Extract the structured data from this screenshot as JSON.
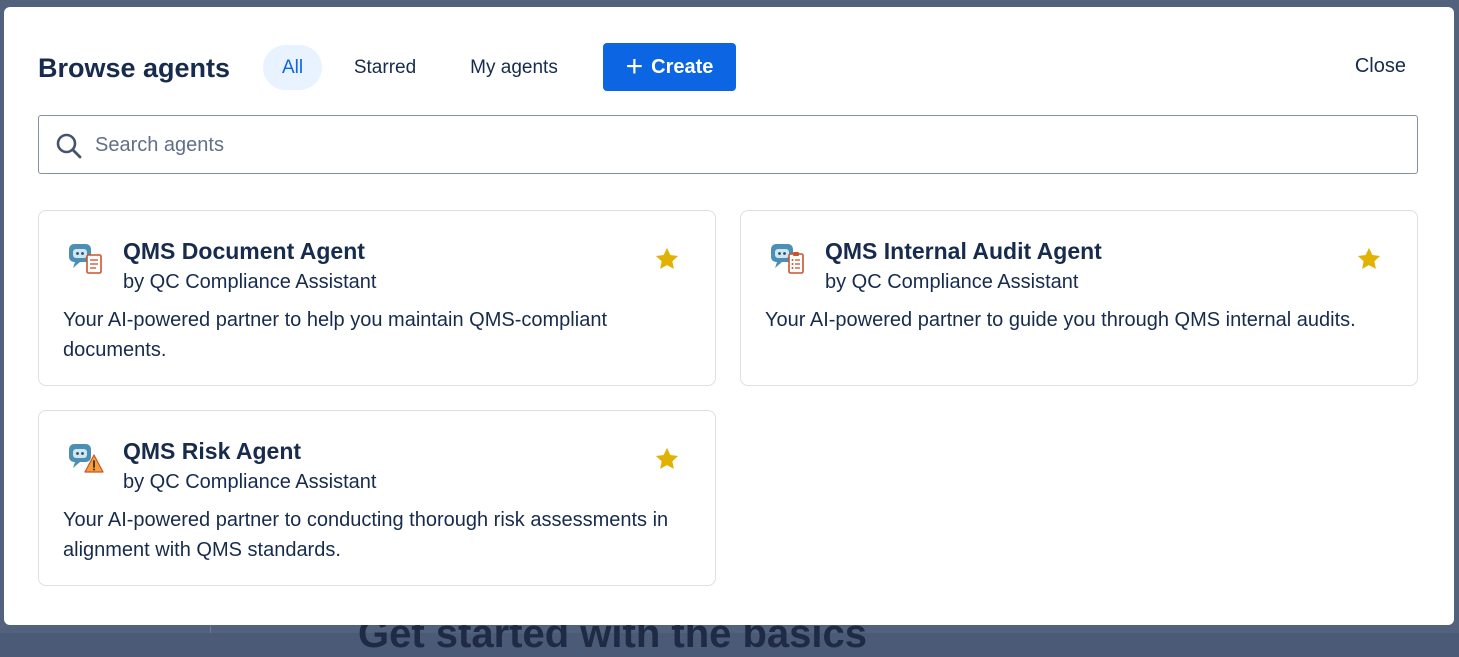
{
  "header": {
    "title": "Browse agents",
    "tabs": [
      {
        "label": "All",
        "active": true
      },
      {
        "label": "Starred",
        "active": false
      },
      {
        "label": "My agents",
        "active": false
      }
    ],
    "create_label": "Create",
    "close_label": "Close"
  },
  "search": {
    "placeholder": "Search agents",
    "value": ""
  },
  "agents": [
    {
      "name": "QMS Document Agent",
      "by": "by QC Compliance Assistant",
      "description": "Your AI-powered partner to help you maintain QMS-compliant documents.",
      "starred": true,
      "icon": "robot-document-icon"
    },
    {
      "name": "QMS Internal Audit Agent",
      "by": "by QC Compliance Assistant",
      "description": "Your AI-powered partner to guide you through QMS internal audits.",
      "starred": true,
      "icon": "robot-checklist-icon"
    },
    {
      "name": "QMS Risk Agent",
      "by": "by QC Compliance Assistant",
      "description": "Your AI-powered partner to conducting thorough risk assessments in alignment with QMS standards.",
      "starred": true,
      "icon": "robot-warning-icon"
    }
  ],
  "background": {
    "partial_heading": "Get started with the basics"
  },
  "colors": {
    "primary": "#0c66e4",
    "active_tab_bg": "#e9f2ff",
    "text": "#172b4d",
    "star": "#e2b203",
    "overlay": "#52617c"
  }
}
